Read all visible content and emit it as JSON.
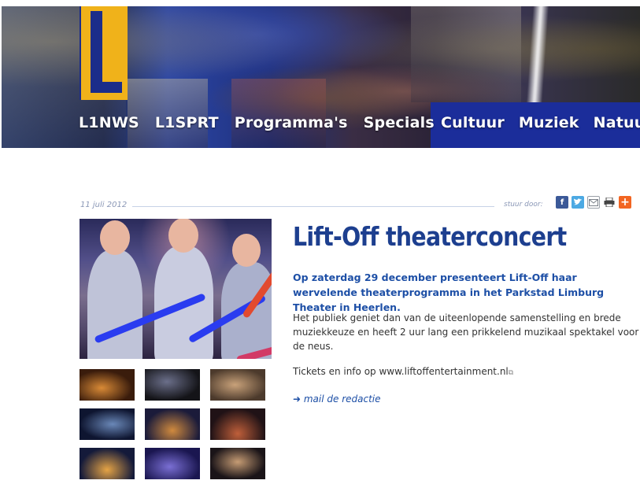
{
  "header": {
    "nav_left": [
      "L1NWS",
      "L1SPRT",
      "Programma's",
      "Specials"
    ],
    "nav_right": [
      "Cultuur",
      "Muziek",
      "Natuur"
    ],
    "brand_colors": {
      "yellow": "#f0b21a",
      "blue": "#1b2d8a"
    }
  },
  "article": {
    "date": "11 juli 2012",
    "share_label": "stuur door:",
    "share_icons": [
      "facebook-icon",
      "twitter-icon",
      "mail-icon",
      "print-icon",
      "add-icon"
    ],
    "title": "Lift-Off theaterconcert",
    "lead": "Op zaterdag 29 december presenteert Lift-Off haar wervelende theaterprogramma in het Parkstad Limburg Theater in Heerlen.",
    "body": "Het publiek geniet dan van de uiteenlopende samenstelling en brede muziekkeuze en heeft 2 uur lang een prikkelend muzikaal spektakel voor de neus.",
    "tickets_prefix": "Tickets en info op ",
    "tickets_link": "www.liftoffentertainment.nl",
    "mail_link": "➜ mail de redactie",
    "thumbnail_count": 9
  }
}
